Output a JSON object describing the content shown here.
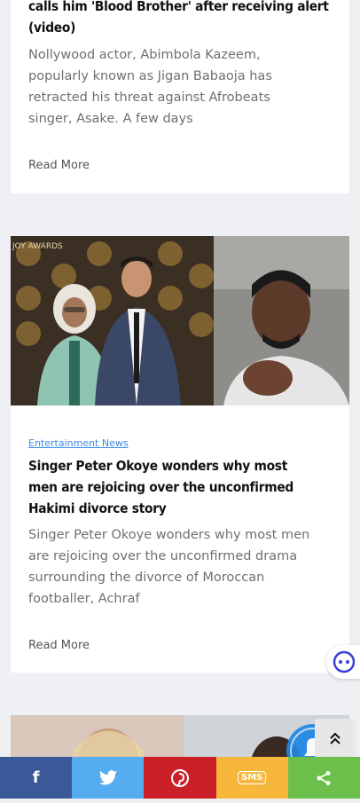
{
  "article1": {
    "title_line1": "calls him 'Blood Brother' after receiving alert",
    "title_line2": "(video)",
    "excerpt": "Nollywood actor, Abimbola Kazeem, popularly known as Jigan Babaoja has retracted his threat against Afrobeats singer, Asake. A few days",
    "read_more": "Read More"
  },
  "article2": {
    "category": "Entertainment News",
    "title": "Singer Peter Okoye wonders why most men are rejoicing over the unconfirmed Hakimi divorce story",
    "excerpt": "Singer Peter Okoye wonders why most men are rejoicing over the unconfirmed drama surrounding the divorce of Moroccan footballer, Achraf",
    "read_more": "Read More",
    "image_sign": "JOY AWARDS"
  },
  "share": {
    "facebook": "f",
    "sms": "SMS"
  },
  "colors": {
    "facebook": "#3b5998",
    "twitter": "#55acee",
    "pinterest": "#cb2027",
    "sms": "#f6b73c",
    "share": "#6cbf4a",
    "link": "#3b8be6"
  },
  "icons": [
    "facebook-icon",
    "twitter-icon",
    "pinterest-icon",
    "sms-icon",
    "share-icon",
    "bell-icon",
    "chat-icon",
    "scroll-top-icon"
  ]
}
